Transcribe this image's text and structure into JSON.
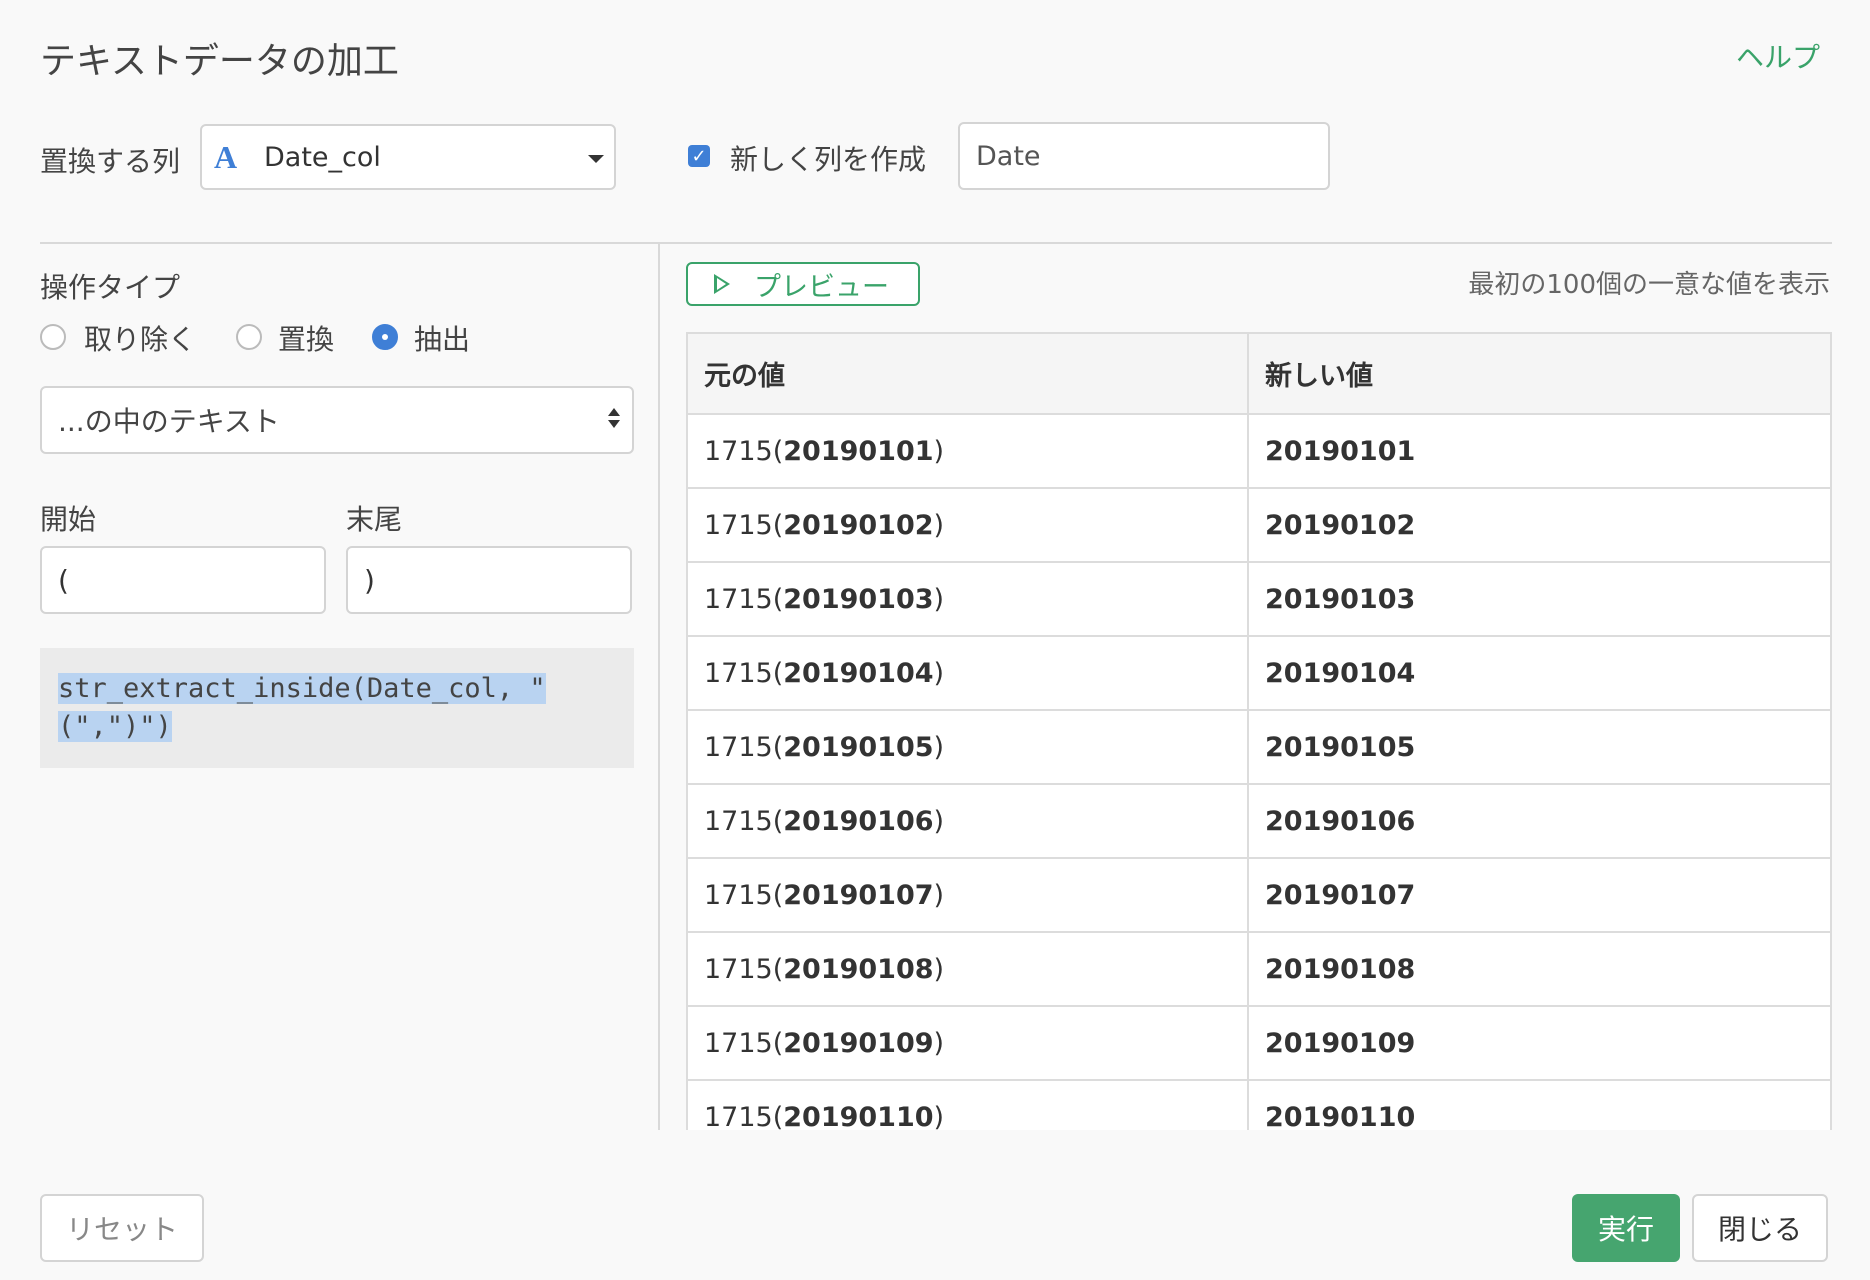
{
  "dialog": {
    "title": "テキストデータの加工",
    "help_label": "ヘルプ"
  },
  "column": {
    "label": "置換する列",
    "type_icon": "A",
    "selected": "Date_col"
  },
  "new_column": {
    "checkbox_label": "新しく列を作成",
    "checked": true,
    "value": "Date"
  },
  "operation": {
    "label": "操作タイプ",
    "options": [
      "取り除く",
      "置換",
      "抽出"
    ],
    "selected": "抽出",
    "mode": "...の中のテキスト"
  },
  "range": {
    "start_label": "開始",
    "start_value": "(",
    "end_label": "末尾",
    "end_value": ")"
  },
  "code": "str_extract_inside(Date_col, \"(\",\")\")",
  "preview": {
    "button_label": "プレビュー",
    "note": "最初の100個の一意な値を表示"
  },
  "table": {
    "headers": [
      "元の値",
      "新しい値"
    ],
    "rows": [
      {
        "orig_prefix": "1715(",
        "orig_bold": "20190101",
        "orig_suffix": ")",
        "new": "20190101"
      },
      {
        "orig_prefix": "1715(",
        "orig_bold": "20190102",
        "orig_suffix": ")",
        "new": "20190102"
      },
      {
        "orig_prefix": "1715(",
        "orig_bold": "20190103",
        "orig_suffix": ")",
        "new": "20190103"
      },
      {
        "orig_prefix": "1715(",
        "orig_bold": "20190104",
        "orig_suffix": ")",
        "new": "20190104"
      },
      {
        "orig_prefix": "1715(",
        "orig_bold": "20190105",
        "orig_suffix": ")",
        "new": "20190105"
      },
      {
        "orig_prefix": "1715(",
        "orig_bold": "20190106",
        "orig_suffix": ")",
        "new": "20190106"
      },
      {
        "orig_prefix": "1715(",
        "orig_bold": "20190107",
        "orig_suffix": ")",
        "new": "20190107"
      },
      {
        "orig_prefix": "1715(",
        "orig_bold": "20190108",
        "orig_suffix": ")",
        "new": "20190108"
      },
      {
        "orig_prefix": "1715(",
        "orig_bold": "20190109",
        "orig_suffix": ")",
        "new": "20190109"
      },
      {
        "orig_prefix": "1715(",
        "orig_bold": "20190110",
        "orig_suffix": ")",
        "new": "20190110"
      }
    ]
  },
  "footer": {
    "reset_label": "リセット",
    "run_label": "実行",
    "close_label": "閉じる"
  },
  "colors": {
    "accent_green": "#3aa36a",
    "accent_blue": "#3f7fd6"
  }
}
